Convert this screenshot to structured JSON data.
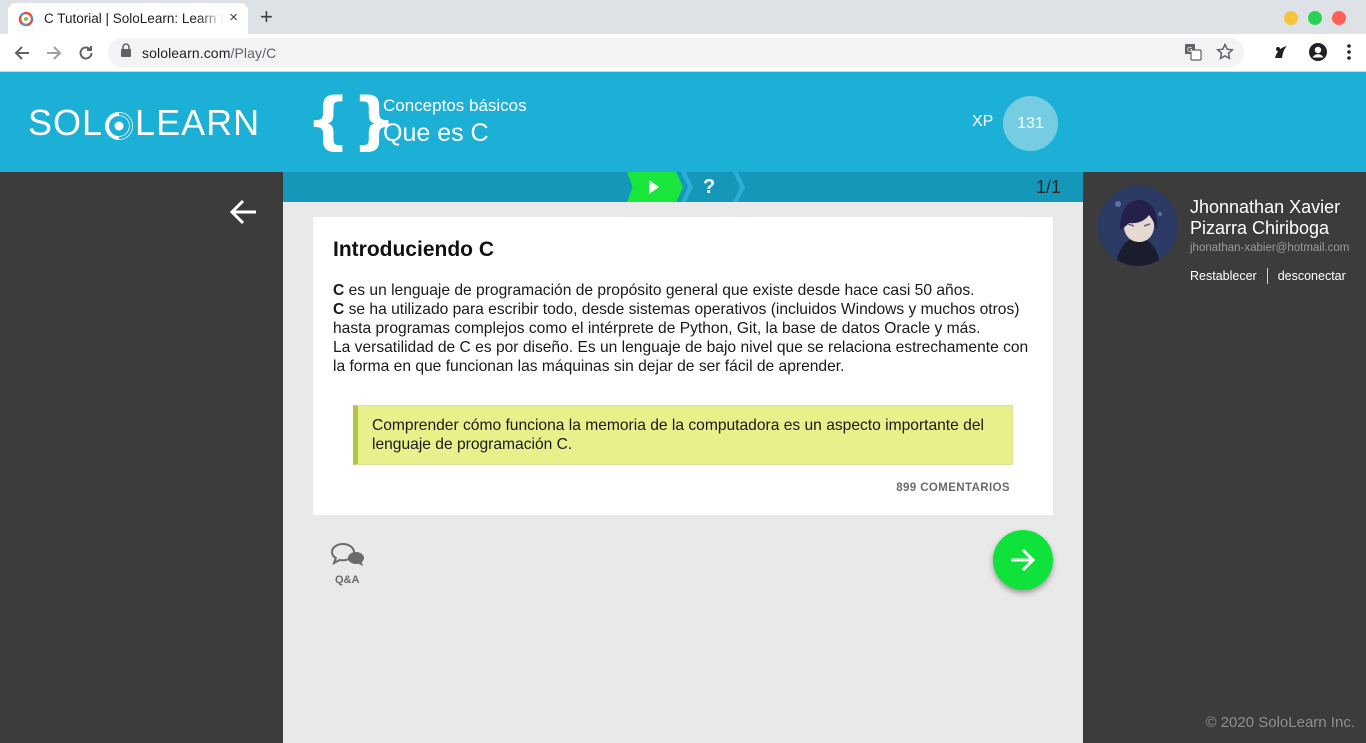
{
  "browser": {
    "tab_title": "C Tutorial | SoloLearn: Learn to Code",
    "tab_close": "×",
    "new_tab": "+",
    "url_host": "sololearn.com",
    "url_path": "/Play/C",
    "window_colors": [
      "#f5c43d",
      "#2bd154",
      "#ff5f57"
    ]
  },
  "header": {
    "logo_left": "SOL",
    "logo_right": "LEARN",
    "module_icon": "{}",
    "module": "Conceptos básicos",
    "lesson": "Que es C",
    "xp_label": "XP",
    "xp_value": "131"
  },
  "progress": {
    "question_mark": "?",
    "count": "1/1"
  },
  "card": {
    "title": "Introduciendo C",
    "p1_bold": "C",
    "p1": " es un lenguaje de programación de propósito general que existe desde hace casi 50 años.",
    "p2_bold": "C",
    "p2": " se ha utilizado para escribir todo, desde sistemas operativos (incluidos Windows y muchos otros) hasta programas complejos como el intérprete de Python, Git, la base de datos Oracle y más.",
    "p3": "La versatilidad de C es por diseño. Es un lenguaje de bajo nivel que se relaciona estrechamente con la forma en que funcionan las máquinas sin dejar de ser fácil de aprender.",
    "note": "Comprender cómo funciona la memoria de la computadora es un aspecto importante del lenguaje de programación C.",
    "comments": "899 COMENTARIOS"
  },
  "qa": {
    "label": "Q&A"
  },
  "user": {
    "name": "Jhonnathan Xavier Pizarra Chiriboga",
    "email": "jhonathan-xabier@hotmail.com",
    "reset": "Restablecer",
    "logout": "desconectar"
  },
  "footer": {
    "copyright": "© 2020 SoloLearn Inc."
  }
}
